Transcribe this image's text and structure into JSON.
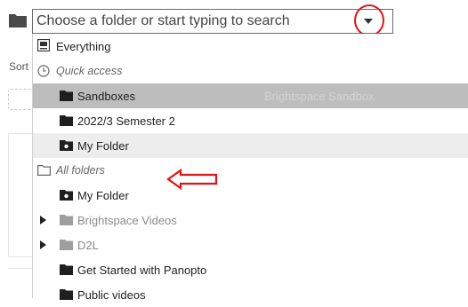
{
  "search": {
    "placeholder": "Choose a folder or start typing to search"
  },
  "background": {
    "sort_label": "Sort"
  },
  "dropdown": {
    "everything": "Everything",
    "quick_access": {
      "heading": "Quick access",
      "items": [
        "Sandboxes",
        "2022/3 Semester 2",
        "My Folder"
      ]
    },
    "all_folders": {
      "heading": "All folders",
      "items": [
        "My Folder",
        "Brightspace Videos",
        "D2L",
        "Get Started with Panopto",
        "Public videos"
      ]
    },
    "ghost_text": "Brightspace Sandbox"
  },
  "colors": {
    "annotation_red": "#e01414",
    "highlight_dark": "#bdbdbd",
    "highlight_light": "#ededed",
    "muted_folder": "#9e9e9e"
  },
  "icons": {
    "everything": "list-box-icon",
    "quick_access": "clock-icon",
    "all_folders": "folder-outline-icon",
    "folder": "folder-icon",
    "shared_folder": "shared-folder-icon",
    "caret": "caret-down-icon"
  }
}
